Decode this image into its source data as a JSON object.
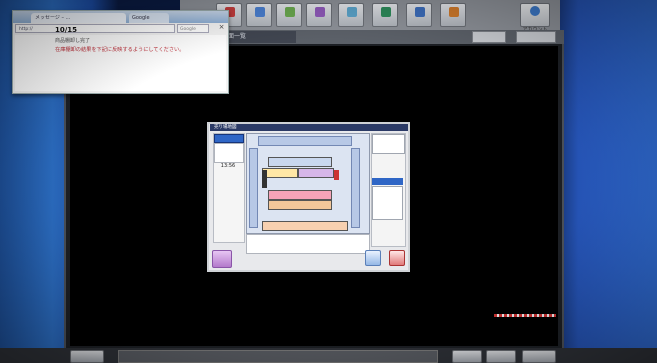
{
  "browser": {
    "tab_title": "メッセージ – ...",
    "tab2_title": "Google",
    "address": "http://",
    "search_placeholder": "Google",
    "close_label": "×",
    "message_title": "10/15",
    "message_sub": "商品棚卸し完了",
    "message_body": "在庫棚卸の結果を下記に反映するようにしてください。"
  },
  "app": {
    "toolbar_buttons": [
      "",
      "",
      "",
      "",
      "",
      "",
      "",
      ""
    ],
    "toolbar_right": "アカウント",
    "tab_label": "画面一覧",
    "sub_btn_1": "",
    "sub_btn_2": ""
  },
  "preview": {
    "title": "売り場地図",
    "left_button": "",
    "date": "",
    "time": "13:56",
    "note": "",
    "right_top": "",
    "right_blue": "",
    "right_list": [
      "",
      "",
      "",
      "",
      "",
      ""
    ],
    "shelves": [
      "",
      "",
      "",
      "",
      "",
      ""
    ]
  }
}
